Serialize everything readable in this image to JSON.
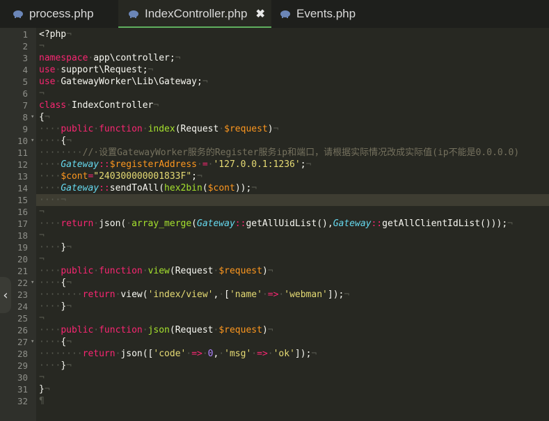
{
  "tabs": [
    {
      "label": "process.php",
      "icon": "php-elephant-icon",
      "active": false
    },
    {
      "label": "IndexController.php",
      "icon": "php-elephant-icon",
      "active": true,
      "close": "✖"
    },
    {
      "label": "Events.php",
      "icon": "php-elephant-icon",
      "active": false
    }
  ],
  "colors": {
    "keyword": "#f92672",
    "type": "#66d9ef",
    "variable": "#fd971f",
    "function": "#a6e22e",
    "string": "#e6db74",
    "number": "#ae81ff",
    "comment": "#75715e",
    "active_tab_underline": "#5fb05f"
  },
  "collapse_glyph": "‹",
  "current_line": 15,
  "lines": [
    {
      "n": "1",
      "fold": "",
      "tokens": [
        [
          "plain",
          "<?php"
        ],
        [
          "ws",
          "¬"
        ]
      ]
    },
    {
      "n": "2",
      "fold": "",
      "tokens": [
        [
          "ws",
          "¬"
        ]
      ]
    },
    {
      "n": "3",
      "fold": "",
      "tokens": [
        [
          "kw",
          "namespace"
        ],
        [
          "ws",
          "·"
        ],
        [
          "plain",
          "app\\controller;"
        ],
        [
          "ws",
          "¬"
        ]
      ]
    },
    {
      "n": "4",
      "fold": "",
      "tokens": [
        [
          "kw",
          "use"
        ],
        [
          "ws",
          "·"
        ],
        [
          "plain",
          "support\\Request;"
        ],
        [
          "ws",
          "¬"
        ]
      ]
    },
    {
      "n": "5",
      "fold": "",
      "tokens": [
        [
          "kw",
          "use"
        ],
        [
          "ws",
          "·"
        ],
        [
          "plain",
          "GatewayWorker\\Lib\\Gateway;"
        ],
        [
          "ws",
          "¬"
        ]
      ]
    },
    {
      "n": "6",
      "fold": "",
      "tokens": [
        [
          "ws",
          "¬"
        ]
      ]
    },
    {
      "n": "7",
      "fold": "",
      "tokens": [
        [
          "kw",
          "class"
        ],
        [
          "ws",
          "·"
        ],
        [
          "plain",
          "IndexController"
        ],
        [
          "ws",
          "¬"
        ]
      ]
    },
    {
      "n": "8",
      "fold": "▾",
      "tokens": [
        [
          "plain",
          "{"
        ],
        [
          "ws",
          "¬"
        ]
      ]
    },
    {
      "n": "9",
      "fold": "",
      "tokens": [
        [
          "ws",
          "····"
        ],
        [
          "kw",
          "public"
        ],
        [
          "ws",
          "·"
        ],
        [
          "kw",
          "function"
        ],
        [
          "ws",
          "·"
        ],
        [
          "func",
          "index"
        ],
        [
          "plain",
          "(Request"
        ],
        [
          "ws",
          "·"
        ],
        [
          "var",
          "$request"
        ],
        [
          "plain",
          ")"
        ],
        [
          "ws",
          "¬"
        ]
      ]
    },
    {
      "n": "10",
      "fold": "▾",
      "tokens": [
        [
          "ws",
          "····"
        ],
        [
          "plain",
          "{"
        ],
        [
          "ws",
          "¬"
        ]
      ]
    },
    {
      "n": "11",
      "fold": "",
      "tokens": [
        [
          "ws",
          "········"
        ],
        [
          "cmt",
          "//·设置GatewayWorker服务的Register服务ip和端口，请根据实际情况改成实际值(ip不能是0.0.0.0)"
        ]
      ]
    },
    {
      "n": "12",
      "fold": "",
      "tokens": [
        [
          "ws",
          "····"
        ],
        [
          "type",
          "Gateway"
        ],
        [
          "kw",
          "::"
        ],
        [
          "var",
          "$registerAddress"
        ],
        [
          "ws",
          "·"
        ],
        [
          "kw",
          "="
        ],
        [
          "ws",
          "·"
        ],
        [
          "str",
          "'127.0.0.1:1236'"
        ],
        [
          "plain",
          ";"
        ],
        [
          "ws",
          "¬"
        ]
      ]
    },
    {
      "n": "13",
      "fold": "",
      "tokens": [
        [
          "ws",
          "····"
        ],
        [
          "var",
          "$cont"
        ],
        [
          "kw",
          "="
        ],
        [
          "str",
          "\"240300000001833F\""
        ],
        [
          "plain",
          ";"
        ],
        [
          "ws",
          "¬"
        ]
      ]
    },
    {
      "n": "14",
      "fold": "",
      "tokens": [
        [
          "ws",
          "····"
        ],
        [
          "type",
          "Gateway"
        ],
        [
          "kw",
          "::"
        ],
        [
          "plain",
          "sendToAll("
        ],
        [
          "func",
          "hex2bin"
        ],
        [
          "plain",
          "("
        ],
        [
          "var",
          "$cont"
        ],
        [
          "plain",
          "));"
        ],
        [
          "ws",
          "¬"
        ]
      ]
    },
    {
      "n": "15",
      "fold": "",
      "tokens": [
        [
          "ws",
          "····¬"
        ]
      ]
    },
    {
      "n": "16",
      "fold": "",
      "tokens": [
        [
          "ws",
          "¬"
        ]
      ]
    },
    {
      "n": "17",
      "fold": "",
      "tokens": [
        [
          "ws",
          "····"
        ],
        [
          "kw",
          "return"
        ],
        [
          "ws",
          "·"
        ],
        [
          "plain",
          "json("
        ],
        [
          "ws",
          "·"
        ],
        [
          "func",
          "array_merge"
        ],
        [
          "plain",
          "("
        ],
        [
          "type",
          "Gateway"
        ],
        [
          "kw",
          "::"
        ],
        [
          "plain",
          "getAllUidList(),"
        ],
        [
          "type",
          "Gateway"
        ],
        [
          "kw",
          "::"
        ],
        [
          "plain",
          "getAllClientIdList()));"
        ],
        [
          "ws",
          "¬"
        ]
      ]
    },
    {
      "n": "18",
      "fold": "",
      "tokens": [
        [
          "ws",
          "¬"
        ]
      ]
    },
    {
      "n": "19",
      "fold": "",
      "tokens": [
        [
          "ws",
          "····"
        ],
        [
          "plain",
          "}"
        ],
        [
          "ws",
          "¬"
        ]
      ]
    },
    {
      "n": "20",
      "fold": "",
      "tokens": [
        [
          "ws",
          "¬"
        ]
      ]
    },
    {
      "n": "21",
      "fold": "",
      "tokens": [
        [
          "ws",
          "····"
        ],
        [
          "kw",
          "public"
        ],
        [
          "ws",
          "·"
        ],
        [
          "kw",
          "function"
        ],
        [
          "ws",
          "·"
        ],
        [
          "func",
          "view"
        ],
        [
          "plain",
          "(Request"
        ],
        [
          "ws",
          "·"
        ],
        [
          "var",
          "$request"
        ],
        [
          "plain",
          ")"
        ],
        [
          "ws",
          "¬"
        ]
      ]
    },
    {
      "n": "22",
      "fold": "▾",
      "tokens": [
        [
          "ws",
          "····"
        ],
        [
          "plain",
          "{"
        ],
        [
          "ws",
          "¬"
        ]
      ]
    },
    {
      "n": "23",
      "fold": "",
      "tokens": [
        [
          "ws",
          "········"
        ],
        [
          "kw",
          "return"
        ],
        [
          "ws",
          "·"
        ],
        [
          "plain",
          "view("
        ],
        [
          "str",
          "'index/view'"
        ],
        [
          "plain",
          ","
        ],
        [
          "ws",
          "·"
        ],
        [
          "plain",
          "["
        ],
        [
          "str",
          "'name'"
        ],
        [
          "ws",
          "·"
        ],
        [
          "kw",
          "=>"
        ],
        [
          "ws",
          "·"
        ],
        [
          "str",
          "'webman'"
        ],
        [
          "plain",
          "]);"
        ],
        [
          "ws",
          "¬"
        ]
      ]
    },
    {
      "n": "24",
      "fold": "",
      "tokens": [
        [
          "ws",
          "····"
        ],
        [
          "plain",
          "}"
        ],
        [
          "ws",
          "¬"
        ]
      ]
    },
    {
      "n": "25",
      "fold": "",
      "tokens": [
        [
          "ws",
          "¬"
        ]
      ]
    },
    {
      "n": "26",
      "fold": "",
      "tokens": [
        [
          "ws",
          "····"
        ],
        [
          "kw",
          "public"
        ],
        [
          "ws",
          "·"
        ],
        [
          "kw",
          "function"
        ],
        [
          "ws",
          "·"
        ],
        [
          "func",
          "json"
        ],
        [
          "plain",
          "(Request"
        ],
        [
          "ws",
          "·"
        ],
        [
          "var",
          "$request"
        ],
        [
          "plain",
          ")"
        ],
        [
          "ws",
          "¬"
        ]
      ]
    },
    {
      "n": "27",
      "fold": "▾",
      "tokens": [
        [
          "ws",
          "····"
        ],
        [
          "plain",
          "{"
        ],
        [
          "ws",
          "¬"
        ]
      ]
    },
    {
      "n": "28",
      "fold": "",
      "tokens": [
        [
          "ws",
          "········"
        ],
        [
          "kw",
          "return"
        ],
        [
          "ws",
          "·"
        ],
        [
          "plain",
          "json(["
        ],
        [
          "str",
          "'code'"
        ],
        [
          "ws",
          "·"
        ],
        [
          "kw",
          "=>"
        ],
        [
          "ws",
          "·"
        ],
        [
          "num",
          "0"
        ],
        [
          "plain",
          ","
        ],
        [
          "ws",
          "·"
        ],
        [
          "str",
          "'msg'"
        ],
        [
          "ws",
          "·"
        ],
        [
          "kw",
          "=>"
        ],
        [
          "ws",
          "·"
        ],
        [
          "str",
          "'ok'"
        ],
        [
          "plain",
          "]);"
        ],
        [
          "ws",
          "¬"
        ]
      ]
    },
    {
      "n": "29",
      "fold": "",
      "tokens": [
        [
          "ws",
          "····"
        ],
        [
          "plain",
          "}"
        ],
        [
          "ws",
          "¬"
        ]
      ]
    },
    {
      "n": "30",
      "fold": "",
      "tokens": [
        [
          "ws",
          "¬"
        ]
      ]
    },
    {
      "n": "31",
      "fold": "",
      "tokens": [
        [
          "plain",
          "}"
        ],
        [
          "ws",
          "¬"
        ]
      ]
    },
    {
      "n": "32",
      "fold": "",
      "tokens": [
        [
          "ws",
          "¶"
        ]
      ]
    }
  ]
}
